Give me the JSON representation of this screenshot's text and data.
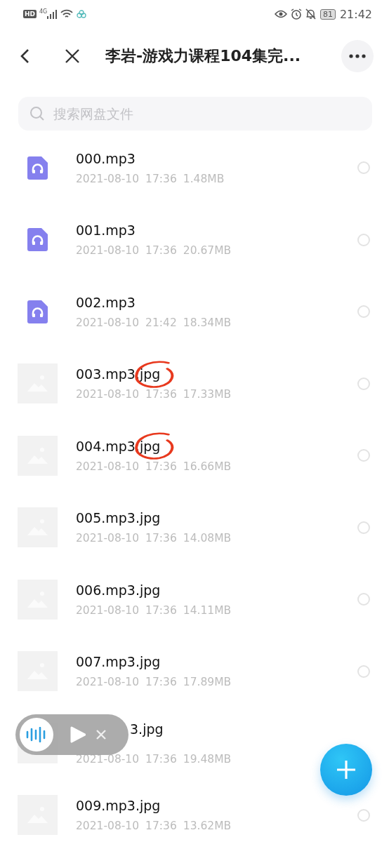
{
  "status_bar": {
    "hd": "HD",
    "network": "4G",
    "battery": "81",
    "time": "21:42"
  },
  "header": {
    "title": "李岩-游戏力课程104集完..."
  },
  "search": {
    "placeholder": "搜索网盘文件"
  },
  "files": [
    {
      "kind": "audio",
      "name": "000.mp3",
      "date": "2021-08-10",
      "time": "17:36",
      "size": "1.48MB",
      "selected": false,
      "annotated": false,
      "partly_hidden": false
    },
    {
      "kind": "audio",
      "name": "001.mp3",
      "date": "2021-08-10",
      "time": "17:36",
      "size": "20.67MB",
      "selected": false,
      "annotated": false,
      "partly_hidden": false
    },
    {
      "kind": "audio",
      "name": "002.mp3",
      "date": "2021-08-10",
      "time": "21:42",
      "size": "18.34MB",
      "selected": false,
      "annotated": false,
      "partly_hidden": false
    },
    {
      "kind": "image",
      "name": "003.mp3.jpg",
      "date": "2021-08-10",
      "time": "17:36",
      "size": "17.33MB",
      "selected": false,
      "annotated": true,
      "partly_hidden": false
    },
    {
      "kind": "image",
      "name": "004.mp3.jpg",
      "date": "2021-08-10",
      "time": "17:36",
      "size": "16.66MB",
      "selected": false,
      "annotated": true,
      "partly_hidden": false
    },
    {
      "kind": "image",
      "name": "005.mp3.jpg",
      "date": "2021-08-10",
      "time": "17:36",
      "size": "14.08MB",
      "selected": false,
      "annotated": false,
      "partly_hidden": false
    },
    {
      "kind": "image",
      "name": "006.mp3.jpg",
      "date": "2021-08-10",
      "time": "17:36",
      "size": "14.11MB",
      "selected": false,
      "annotated": false,
      "partly_hidden": false
    },
    {
      "kind": "image",
      "name": "007.mp3.jpg",
      "date": "2021-08-10",
      "time": "17:36",
      "size": "17.89MB",
      "selected": false,
      "annotated": false,
      "partly_hidden": false
    },
    {
      "kind": "image",
      "name": "3.jpg",
      "date": "2021-08-10",
      "time": "17:36",
      "size": "19.48MB",
      "annotated": false,
      "partly_hidden": true
    },
    {
      "kind": "image",
      "name": "009.mp3.jpg",
      "date": "2021-08-10",
      "time": "17:36",
      "size": "13.62MB",
      "selected": false,
      "annotated": false,
      "partly_hidden": false
    }
  ],
  "mini_player": {
    "playing": false
  }
}
